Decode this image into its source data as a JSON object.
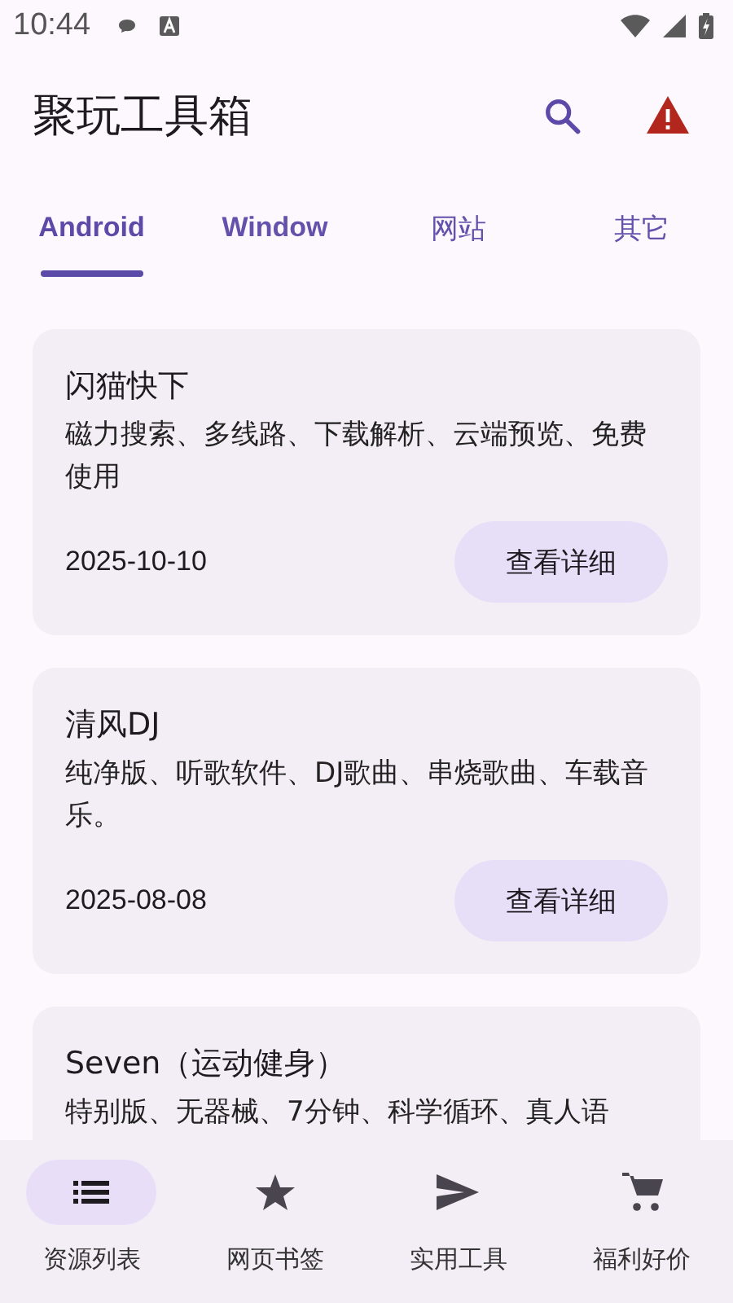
{
  "status_bar": {
    "time": "10:44"
  },
  "app_bar": {
    "title": "聚玩工具箱"
  },
  "tabs": [
    {
      "label": "Android",
      "selected": true
    },
    {
      "label": "Window",
      "selected": false
    },
    {
      "label": "网站",
      "selected": false
    },
    {
      "label": "其它",
      "selected": false
    }
  ],
  "cards": [
    {
      "title": "闪猫快下",
      "description": "磁力搜索、多线路、下载解析、云端预览、免费使用",
      "date": "2025-10-10",
      "button": "查看详细"
    },
    {
      "title": "清风DJ",
      "description": "纯净版、听歌软件、DJ歌曲、串烧歌曲、车载音乐。",
      "date": "2025-08-08",
      "button": "查看详细"
    },
    {
      "title": "Seven（运动健身）",
      "description": "特别版、无器械、7分钟、科学循环、真人语"
    }
  ],
  "bottom_nav": [
    {
      "label": "资源列表",
      "selected": true
    },
    {
      "label": "网页书签",
      "selected": false
    },
    {
      "label": "实用工具",
      "selected": false
    },
    {
      "label": "福利好价",
      "selected": false
    }
  ]
}
